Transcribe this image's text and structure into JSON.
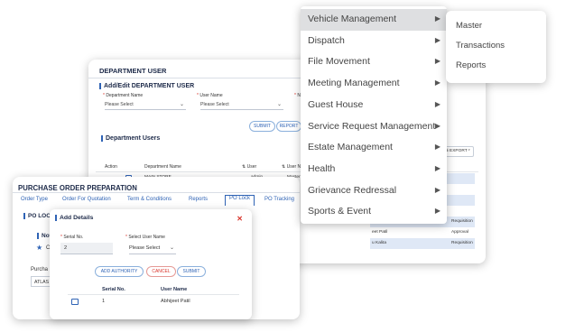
{
  "department": {
    "title": "DEPARTMENT USER",
    "section_add": "Add/Edit DEPARTMENT USER",
    "department_name_label": "Department Name",
    "user_name_label": "User Name",
    "third_label": "N",
    "department_select_value": "Please Select",
    "user_select_value": "Please Select",
    "submit_label": "SUBMIT",
    "report_label": "REPORT",
    "section_users": "Department Users",
    "export_label": "EXPORT",
    "columns": [
      "Action",
      "Department Name",
      "User",
      "User N"
    ],
    "row": {
      "department": "MAIN STORE",
      "user": "admin",
      "user_name": "Master"
    },
    "right_rows": [
      {
        "name": "P Chaudhary",
        "role": "Requisition"
      },
      {
        "name": "eet Patil",
        "role": "Approval"
      },
      {
        "name": "u Kalita",
        "role": "Requisition"
      }
    ]
  },
  "po": {
    "title": "PURCHASE ORDER PREPARATION",
    "tabs": [
      "Order Type",
      "Order For Quotation",
      "Term & Conditions",
      "Reports",
      "PO Lock",
      "PO Tracking"
    ],
    "section": "PO LOC",
    "note": "Not",
    "star_text": "C",
    "purchase_label": "Purcha",
    "purchase_value": "ATLAS"
  },
  "modal": {
    "title": "Add Details",
    "serial_label": "Serial No.",
    "serial_value": "2",
    "user_label": "Select User Name",
    "user_select_value": "Please Select",
    "add_authority_label": "ADD AUTHORITY",
    "cancel_label": "CANCEL",
    "submit_label": "SUBMIT",
    "columns": [
      "Serial No.",
      "User Name"
    ],
    "row": {
      "serial": "1",
      "user": "Abhijeet Patil"
    }
  },
  "menu": {
    "items": [
      "Vehicle Management",
      "Dispatch",
      "File Movement",
      "Meeting Management",
      "Guest House",
      "Service Request Management",
      "Estate Management",
      "Health",
      "Grievance Redressal",
      "Sports & Event"
    ],
    "active_index": 0,
    "submenu": [
      "Master",
      "Transactions",
      "Reports"
    ]
  },
  "colors": {
    "accent": "#2f63b5",
    "danger": "#d9342b",
    "heading": "#1e2b4a",
    "hover": "#dedfe1",
    "row_alt": "#dfe8f6"
  }
}
